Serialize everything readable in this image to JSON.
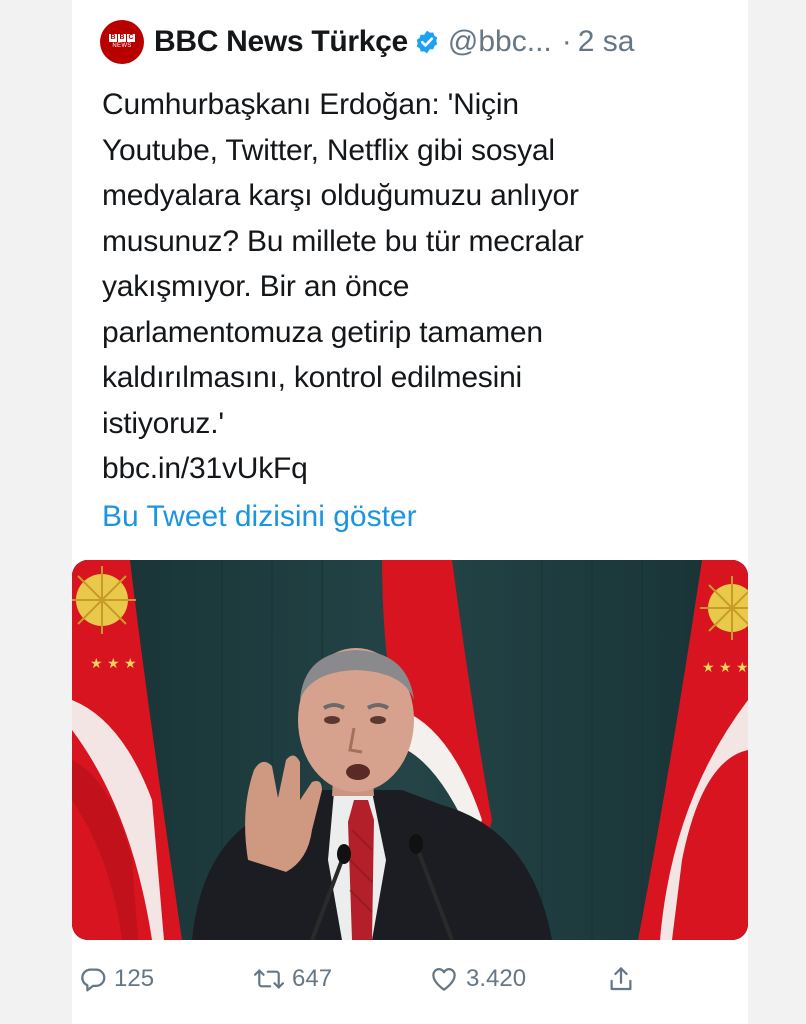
{
  "header": {
    "display_name": "BBC News Türkçe",
    "handle": "@bbc...",
    "separator": "·",
    "time": "2 sa",
    "avatar_text": "NEWS"
  },
  "tweet": {
    "lines": [
      "Cumhurbaşkanı Erdoğan: 'Niçin",
      "Youtube, Twitter, Netflix gibi sosyal",
      "medyalara karşı olduğumuzu anlıyor",
      "musunuz? Bu millete bu tür mecralar",
      "yakışmıyor. Bir an önce",
      "parlamentomuza getirip tamamen",
      "kaldırılmasını, kontrol edilmesini",
      "istiyoruz.'",
      "bbc.in/31vUkFq"
    ],
    "show_thread": "Bu Tweet dizisini göster"
  },
  "actions": {
    "replies": "125",
    "retweets": "647",
    "likes": "3.420"
  },
  "colors": {
    "text": "#14171a",
    "muted": "#657786",
    "link": "#1b95e0",
    "verified": "#1da1f2",
    "bbc_red": "#b80000",
    "flag_red": "#e30a17"
  }
}
